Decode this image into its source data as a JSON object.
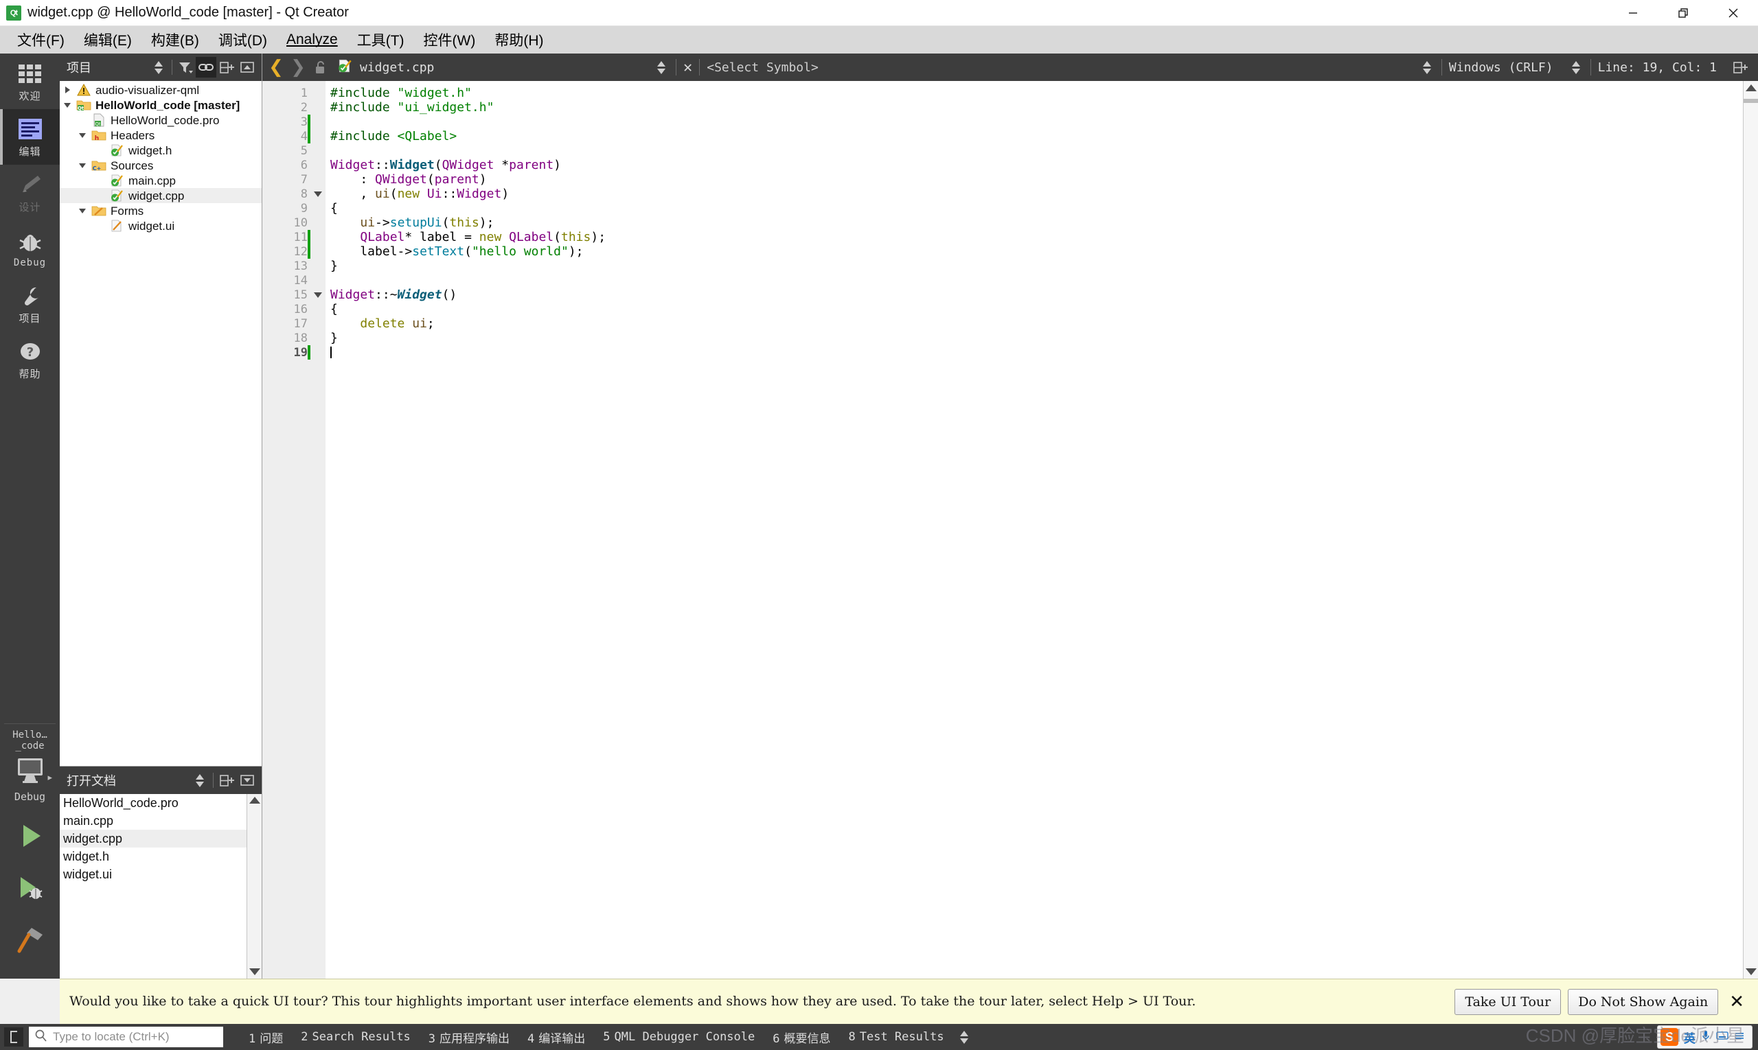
{
  "window": {
    "title": "widget.cpp @ HelloWorld_code [master] - Qt Creator",
    "app_icon": "qt-creator-icon",
    "minimize": "—",
    "restore": "❐",
    "close": "✕"
  },
  "menubar": {
    "items": [
      {
        "label": "文件(F)",
        "mnemonic": "F"
      },
      {
        "label": "编辑(E)",
        "mnemonic": "E"
      },
      {
        "label": "构建(B)",
        "mnemonic": "B"
      },
      {
        "label": "调试(D)",
        "mnemonic": "D"
      },
      {
        "label": "Analyze",
        "mnemonic": "A"
      },
      {
        "label": "工具(T)",
        "mnemonic": "T"
      },
      {
        "label": "控件(W)",
        "mnemonic": "W"
      },
      {
        "label": "帮助(H)",
        "mnemonic": "H"
      }
    ]
  },
  "modebar": {
    "modes": [
      {
        "label": "欢迎",
        "icon": "grid-icon",
        "state": "normal"
      },
      {
        "label": "编辑",
        "icon": "edit-lines-icon",
        "state": "active"
      },
      {
        "label": "设计",
        "icon": "pencil-icon",
        "state": "disabled"
      },
      {
        "label": "Debug",
        "icon": "bug-icon",
        "state": "normal"
      },
      {
        "label": "项目",
        "icon": "wrench-icon",
        "state": "normal"
      },
      {
        "label": "帮助",
        "icon": "question-mark-icon",
        "state": "normal"
      }
    ],
    "kit": {
      "project": "Hello…_code",
      "build_config": "Debug",
      "target_icon": "desktop-monitor-icon",
      "arrow": "▸",
      "run_icon": "run-play-icon",
      "debug_icon": "run-debug-icon",
      "build_icon": "hammer-icon"
    }
  },
  "project_panel": {
    "title": "项目",
    "toolbar": [
      {
        "name": "filter-sync-selector",
        "icon": "up-down-spinner-icon"
      },
      {
        "name": "filter",
        "icon": "funnel-icon"
      },
      {
        "name": "sync-with-editor",
        "icon": "link-icon",
        "active": true
      },
      {
        "name": "split",
        "icon": "split-add-icon"
      },
      {
        "name": "close-panel",
        "icon": "collapse-up-icon"
      }
    ],
    "tree": [
      {
        "label": "audio-visualizer-qml",
        "icon": "warning-triangle-icon",
        "indent": 0,
        "twisty": "collapsed",
        "bold": false,
        "selected": false
      },
      {
        "label": "HelloWorld_code [master]",
        "icon": "qt-project-folder-icon",
        "indent": 0,
        "twisty": "expanded",
        "bold": true,
        "selected": false
      },
      {
        "label": "HelloWorld_code.pro",
        "icon": "qt-pro-file-icon",
        "indent": 1,
        "twisty": "none",
        "bold": false,
        "selected": false
      },
      {
        "label": "Headers",
        "icon": "headers-folder-icon",
        "indent": 1,
        "twisty": "expanded",
        "bold": false,
        "selected": false
      },
      {
        "label": "widget.h",
        "icon": "cpp-file-icon",
        "indent": 2,
        "twisty": "none",
        "bold": false,
        "selected": false
      },
      {
        "label": "Sources",
        "icon": "sources-folder-icon",
        "indent": 1,
        "twisty": "expanded",
        "bold": false,
        "selected": false
      },
      {
        "label": "main.cpp",
        "icon": "cpp-file-icon",
        "indent": 2,
        "twisty": "none",
        "bold": false,
        "selected": false
      },
      {
        "label": "widget.cpp",
        "icon": "cpp-file-icon",
        "indent": 2,
        "twisty": "none",
        "bold": false,
        "selected": true
      },
      {
        "label": "Forms",
        "icon": "forms-folder-icon",
        "indent": 1,
        "twisty": "expanded",
        "bold": false,
        "selected": false
      },
      {
        "label": "widget.ui",
        "icon": "ui-file-icon",
        "indent": 2,
        "twisty": "none",
        "bold": false,
        "selected": false
      }
    ]
  },
  "open_documents": {
    "title": "打开文档",
    "toolbar": [
      {
        "name": "sort-selector",
        "icon": "up-down-spinner-icon"
      },
      {
        "name": "split",
        "icon": "split-add-icon"
      },
      {
        "name": "close-panel",
        "icon": "collapse-down-icon"
      }
    ],
    "items": [
      {
        "label": "HelloWorld_code.pro",
        "selected": false
      },
      {
        "label": "main.cpp",
        "selected": false
      },
      {
        "label": "widget.cpp",
        "selected": true
      },
      {
        "label": "widget.h",
        "selected": false
      },
      {
        "label": "widget.ui",
        "selected": false
      }
    ]
  },
  "editor_toolbar": {
    "back_arrow": "❮",
    "forward_arrow": "❯",
    "lock_icon": "unlocked-padlock-icon",
    "file_icon": "cpp-file-icon",
    "filename": "widget.cpp",
    "close_x": "✕",
    "symbol_selector": "<Select Symbol>",
    "line_ending": "Windows (CRLF)",
    "cursor_position": "Line: 19, Col: 1",
    "split_icon": "split-add-icon"
  },
  "code": {
    "total_lines": 19,
    "current_line": 19,
    "lines": [
      {
        "n": 1,
        "fold": false,
        "changed": false,
        "tokens": [
          {
            "t": "#include",
            "c": "pre"
          },
          {
            "t": " ",
            "c": "txt"
          },
          {
            "t": "\"widget.h\"",
            "c": "str"
          }
        ]
      },
      {
        "n": 2,
        "fold": false,
        "changed": false,
        "tokens": [
          {
            "t": "#include",
            "c": "pre"
          },
          {
            "t": " ",
            "c": "txt"
          },
          {
            "t": "\"ui_widget.h\"",
            "c": "str"
          }
        ]
      },
      {
        "n": 3,
        "fold": false,
        "changed": true,
        "tokens": []
      },
      {
        "n": 4,
        "fold": false,
        "changed": true,
        "tokens": [
          {
            "t": "#include",
            "c": "pre"
          },
          {
            "t": " ",
            "c": "txt"
          },
          {
            "t": "<QLabel>",
            "c": "str"
          }
        ]
      },
      {
        "n": 5,
        "fold": false,
        "changed": false,
        "tokens": []
      },
      {
        "n": 6,
        "fold": false,
        "changed": false,
        "tokens": [
          {
            "t": "Widget",
            "c": "typ"
          },
          {
            "t": "::",
            "c": "txt"
          },
          {
            "t": "Widget",
            "c": "fnb"
          },
          {
            "t": "(",
            "c": "txt"
          },
          {
            "t": "QWidget",
            "c": "typ"
          },
          {
            "t": " *",
            "c": "txt"
          },
          {
            "t": "parent",
            "c": "typ"
          },
          {
            "t": ")",
            "c": "txt"
          }
        ]
      },
      {
        "n": 7,
        "fold": false,
        "changed": false,
        "tokens": [
          {
            "t": "    : ",
            "c": "txt"
          },
          {
            "t": "QWidget",
            "c": "typ"
          },
          {
            "t": "(",
            "c": "txt"
          },
          {
            "t": "parent",
            "c": "typ"
          },
          {
            "t": ")",
            "c": "txt"
          }
        ]
      },
      {
        "n": 8,
        "fold": true,
        "changed": false,
        "tokens": [
          {
            "t": "    , ",
            "c": "txt"
          },
          {
            "t": "ui",
            "c": "var"
          },
          {
            "t": "(",
            "c": "txt"
          },
          {
            "t": "new",
            "c": "kw"
          },
          {
            "t": " ",
            "c": "txt"
          },
          {
            "t": "Ui",
            "c": "typ"
          },
          {
            "t": "::",
            "c": "txt"
          },
          {
            "t": "Widget",
            "c": "typ"
          },
          {
            "t": ")",
            "c": "txt"
          }
        ]
      },
      {
        "n": 9,
        "fold": false,
        "changed": false,
        "tokens": [
          {
            "t": "{",
            "c": "txt"
          }
        ]
      },
      {
        "n": 10,
        "fold": false,
        "changed": false,
        "tokens": [
          {
            "t": "    ",
            "c": "txt"
          },
          {
            "t": "ui",
            "c": "var"
          },
          {
            "t": "->",
            "c": "txt"
          },
          {
            "t": "setupUi",
            "c": "fn"
          },
          {
            "t": "(",
            "c": "txt"
          },
          {
            "t": "this",
            "c": "kw"
          },
          {
            "t": ");",
            "c": "txt"
          }
        ]
      },
      {
        "n": 11,
        "fold": false,
        "changed": true,
        "tokens": [
          {
            "t": "    ",
            "c": "txt"
          },
          {
            "t": "QLabel",
            "c": "typ"
          },
          {
            "t": "* label = ",
            "c": "txt"
          },
          {
            "t": "new",
            "c": "kw"
          },
          {
            "t": " ",
            "c": "txt"
          },
          {
            "t": "QLabel",
            "c": "typ"
          },
          {
            "t": "(",
            "c": "txt"
          },
          {
            "t": "this",
            "c": "kw"
          },
          {
            "t": ");",
            "c": "txt"
          }
        ]
      },
      {
        "n": 12,
        "fold": false,
        "changed": true,
        "tokens": [
          {
            "t": "    label",
            "c": "txt"
          },
          {
            "t": "->",
            "c": "txt"
          },
          {
            "t": "setText",
            "c": "fn"
          },
          {
            "t": "(",
            "c": "txt"
          },
          {
            "t": "\"hello world\"",
            "c": "str"
          },
          {
            "t": ");",
            "c": "txt"
          }
        ]
      },
      {
        "n": 13,
        "fold": false,
        "changed": false,
        "tokens": [
          {
            "t": "}",
            "c": "txt"
          }
        ]
      },
      {
        "n": 14,
        "fold": false,
        "changed": false,
        "tokens": []
      },
      {
        "n": 15,
        "fold": true,
        "changed": false,
        "tokens": [
          {
            "t": "Widget",
            "c": "typ"
          },
          {
            "t": "::~",
            "c": "txt"
          },
          {
            "t": "Widget",
            "c": "fni"
          },
          {
            "t": "()",
            "c": "txt"
          }
        ]
      },
      {
        "n": 16,
        "fold": false,
        "changed": false,
        "tokens": [
          {
            "t": "{",
            "c": "txt"
          }
        ]
      },
      {
        "n": 17,
        "fold": false,
        "changed": false,
        "tokens": [
          {
            "t": "    ",
            "c": "txt"
          },
          {
            "t": "delete",
            "c": "kw"
          },
          {
            "t": " ",
            "c": "txt"
          },
          {
            "t": "ui",
            "c": "var"
          },
          {
            "t": ";",
            "c": "txt"
          }
        ]
      },
      {
        "n": 18,
        "fold": false,
        "changed": false,
        "tokens": [
          {
            "t": "}",
            "c": "txt"
          }
        ]
      },
      {
        "n": 19,
        "fold": false,
        "changed": true,
        "tokens": [],
        "caret": true
      }
    ]
  },
  "tour_banner": {
    "message": "Would you like to take a quick UI tour? This tour highlights important user interface elements and shows how they are used. To take the tour later, select Help > UI Tour.",
    "take_tour_label": "Take UI Tour",
    "dismiss_label": "Do Not Show Again",
    "close": "✕"
  },
  "statusbar": {
    "sidebar_toggle_icon": "sidebar-toggle-icon",
    "locator_placeholder": "Type to locate (Ctrl+K)",
    "locator_icon": "search-icon",
    "panes": [
      {
        "num": "1",
        "label": "问题"
      },
      {
        "num": "2",
        "label": "Search Results"
      },
      {
        "num": "3",
        "label": "应用程序输出"
      },
      {
        "num": "4",
        "label": "编译输出"
      },
      {
        "num": "5",
        "label": "QML Debugger Console"
      },
      {
        "num": "6",
        "label": "概要信息"
      },
      {
        "num": "8",
        "label": "Test Results"
      }
    ],
    "ime": {
      "logo": "S",
      "mode": "英",
      "mic_icon": "microphone-icon",
      "keyboard_icon": "keyboard-icon",
      "menu_icon": "menu-icon"
    },
    "watermark": "CSDN @厚脸宝宝de派小星"
  },
  "colors": {
    "dark_chrome": "#3d3d3d",
    "menu_bg": "#d9d9d9",
    "accent_green": "#12a012",
    "selection": "#eeeeee",
    "banner_bg": "#fbfbd9"
  }
}
